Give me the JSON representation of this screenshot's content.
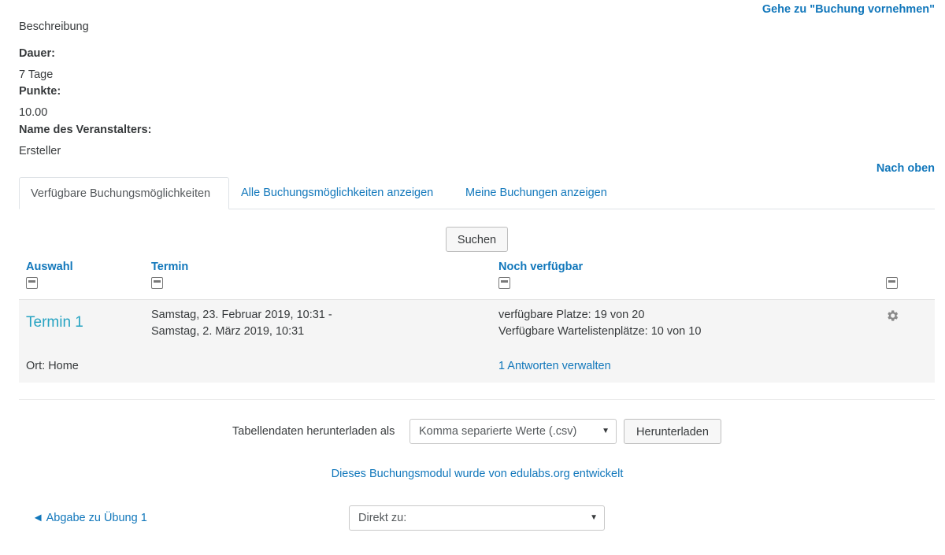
{
  "header": {
    "goto_booking": "Gehe zu \"Buchung vornehmen\""
  },
  "details": {
    "description": "Beschreibung",
    "duration_label": "Dauer:",
    "duration_value": "7 Tage",
    "points_label": "Punkte:",
    "points_value": "10.00",
    "organizer_label": "Name des Veranstalters:",
    "organizer_value": "Ersteller"
  },
  "to_top": "Nach oben",
  "tabs": [
    {
      "label": "Verfügbare Buchungsmöglichkeiten",
      "active": true
    },
    {
      "label": "Alle Buchungsmöglichkeiten anzeigen",
      "active": false
    },
    {
      "label": "Meine Buchungen anzeigen",
      "active": false
    }
  ],
  "search_button": "Suchen",
  "table": {
    "headers": {
      "selection": "Auswahl",
      "date": "Termin",
      "availability": "Noch verfügbar"
    },
    "row": {
      "title": "Termin 1",
      "location": "Ort: Home",
      "date_line1": "Samstag, 23. Februar 2019, 10:31 -",
      "date_line2": "Samstag, 2. März 2019, 10:31",
      "available_places": "verfügbare Platze: 19 von 20",
      "waitlist_places": "Verfügbare Wartelistenplätze: 10 von 10",
      "manage_link": "1 Antworten verwalten"
    }
  },
  "download": {
    "label": "Tabellendaten herunterladen als",
    "format_selected": "Komma separierte Werte (.csv)",
    "button": "Herunterladen"
  },
  "credit": "Dieses Buchungsmodul wurde von edulabs.org entwickelt",
  "footer_nav": {
    "prev_link": "◄ Abgabe zu Übung 1",
    "jump_selected": "Direkt zu:"
  },
  "icons": {
    "collapse": "collapse-icon",
    "gear": "gear-icon",
    "caret": "chevron-down-icon"
  }
}
